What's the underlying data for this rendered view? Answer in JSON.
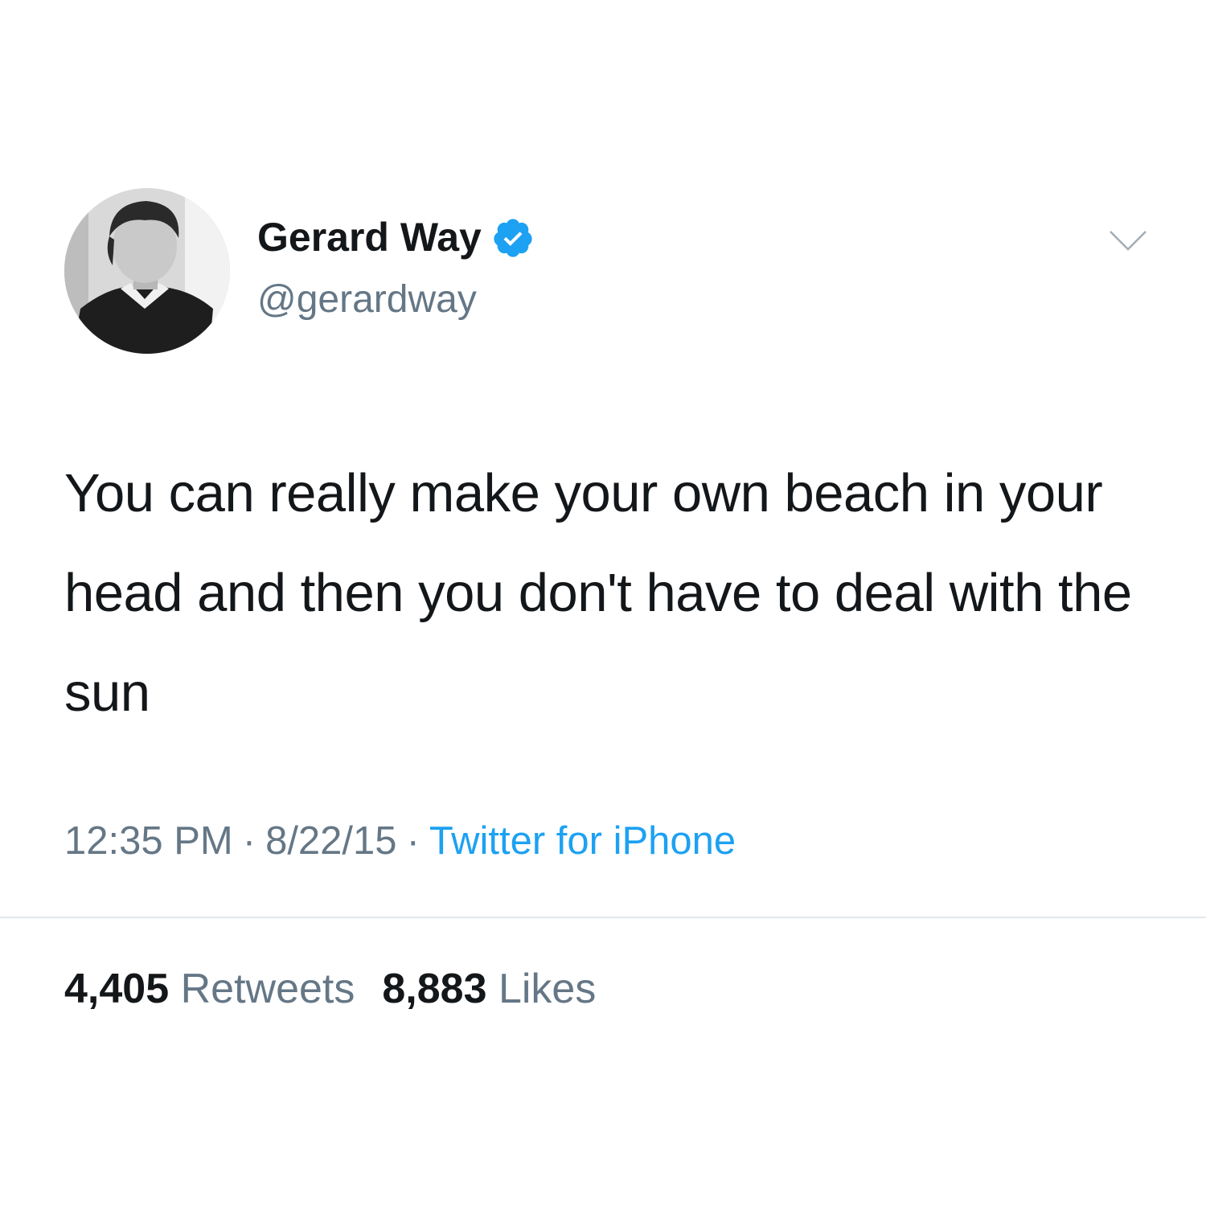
{
  "author": {
    "display_name": "Gerard Way",
    "handle": "@gerardway",
    "verified": true,
    "verified_color": "#1da1f2"
  },
  "tweet": {
    "text": "You can really make your own beach in your head and then you don't have to deal with the sun",
    "time": "12:35 PM",
    "date": "8/22/15",
    "separator": "·",
    "source": "Twitter for iPhone"
  },
  "stats": {
    "retweets_count": "4,405",
    "retweets_label": "Retweets",
    "likes_count": "8,883",
    "likes_label": "Likes"
  },
  "icons": {
    "verified": "verified-badge-icon",
    "menu": "chevron-down-icon"
  },
  "colors": {
    "text_primary": "#14171a",
    "text_secondary": "#657786",
    "link": "#1da1f2",
    "divider": "#e1e8ed"
  }
}
